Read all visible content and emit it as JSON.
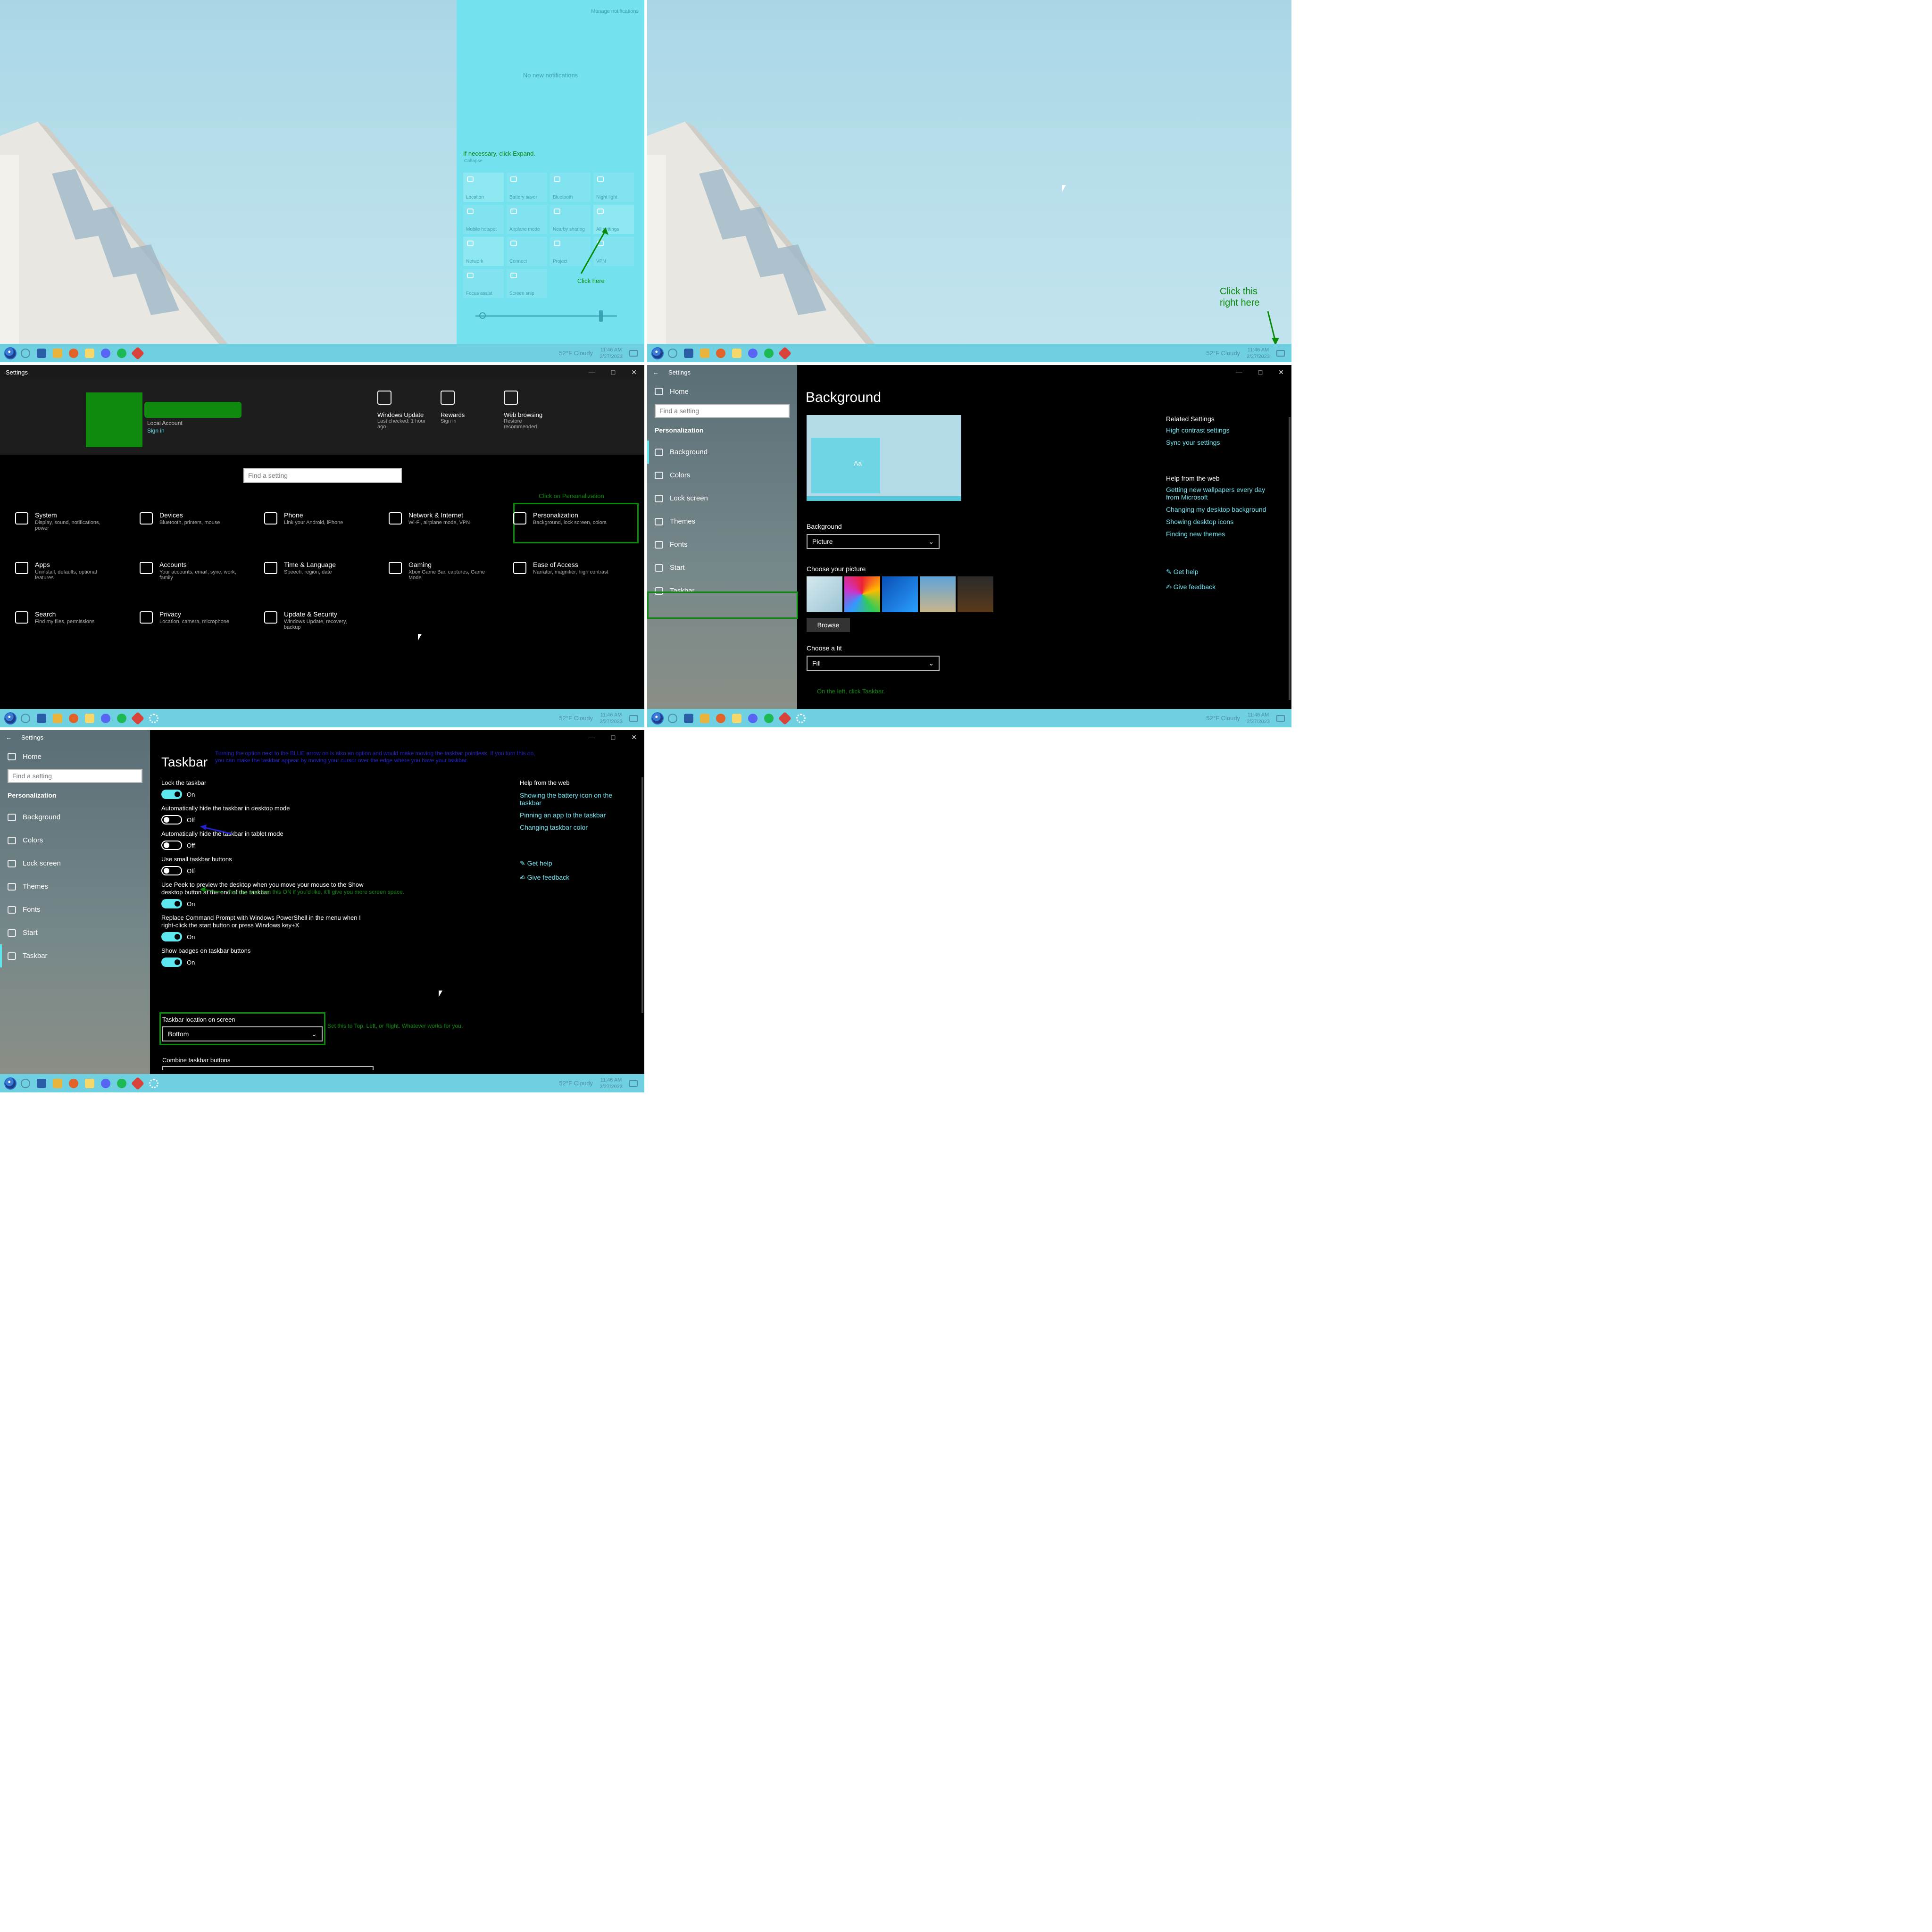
{
  "panel1": {
    "manage_notifications": "Manage notifications",
    "no_notifications": "No new notifications",
    "annotation_expand": "If necessary, click Expand.",
    "collapse": "Collapse",
    "tiles": [
      "Location",
      "Battery saver",
      "Bluetooth",
      "Night light",
      "Mobile hotspot",
      "Airplane mode",
      "Nearby sharing",
      "All settings",
      "Network",
      "Connect",
      "Project",
      "VPN",
      "Focus assist",
      "Screen snip"
    ],
    "annotation_click_here": "Click here"
  },
  "panel2": {
    "annotation_click": "Click this right here"
  },
  "taskbar": {
    "weather": "52°F  Cloudy",
    "time": "11:46 AM",
    "date": "2/27/2023"
  },
  "panel3": {
    "title": "Settings",
    "account_type": "Local Account",
    "sign_in": "Sign in",
    "header_items": [
      {
        "title": "Windows Update",
        "sub": "Last checked: 1 hour ago"
      },
      {
        "title": "Rewards",
        "sub": "Sign in"
      },
      {
        "title": "Web browsing",
        "sub": "Restore recommended"
      }
    ],
    "search_placeholder": "Find a setting",
    "annotation": "Click on Personalization",
    "categories": [
      {
        "title": "System",
        "sub": "Display, sound, notifications, power"
      },
      {
        "title": "Devices",
        "sub": "Bluetooth, printers, mouse"
      },
      {
        "title": "Phone",
        "sub": "Link your Android, iPhone"
      },
      {
        "title": "Network & Internet",
        "sub": "Wi-Fi, airplane mode, VPN"
      },
      {
        "title": "Personalization",
        "sub": "Background, lock screen, colors"
      },
      {
        "title": "Apps",
        "sub": "Uninstall, defaults, optional features"
      },
      {
        "title": "Accounts",
        "sub": "Your accounts, email, sync, work, family"
      },
      {
        "title": "Time & Language",
        "sub": "Speech, region, date"
      },
      {
        "title": "Gaming",
        "sub": "Xbox Game Bar, captures, Game Mode"
      },
      {
        "title": "Ease of Access",
        "sub": "Narrator, magnifier, high contrast"
      },
      {
        "title": "Search",
        "sub": "Find my files, permissions"
      },
      {
        "title": "Privacy",
        "sub": "Location, camera, microphone"
      },
      {
        "title": "Update & Security",
        "sub": "Windows Update, recovery, backup"
      }
    ]
  },
  "panel4": {
    "title": "Settings",
    "home": "Home",
    "search_placeholder": "Find a setting",
    "section": "Personalization",
    "nav": [
      "Background",
      "Colors",
      "Lock screen",
      "Themes",
      "Fonts",
      "Start",
      "Taskbar"
    ],
    "heading": "Background",
    "preview_text": "Aa",
    "background_label": "Background",
    "background_value": "Picture",
    "choose_picture": "Choose your picture",
    "browse": "Browse",
    "choose_fit": "Choose a fit",
    "fit_value": "Fill",
    "annotation": "On the left, click Taskbar.",
    "related_title": "Related Settings",
    "related_links": [
      "High contrast settings",
      "Sync your settings"
    ],
    "help_title": "Help from the web",
    "help_links": [
      "Getting new wallpapers every day from Microsoft",
      "Changing my desktop background",
      "Showing desktop icons",
      "Finding new themes"
    ],
    "get_help": "Get help",
    "give_feedback": "Give feedback"
  },
  "panel5": {
    "title": "Settings",
    "home": "Home",
    "search_placeholder": "Find a setting",
    "section": "Personalization",
    "nav": [
      "Background",
      "Colors",
      "Lock screen",
      "Themes",
      "Fonts",
      "Start",
      "Taskbar"
    ],
    "heading": "Taskbar",
    "annotation_blue": "Turning the option next to the BLUE arrow on is also an option and would make moving the taskbar pointless. If you turn this on, you can make the taskbar appear by moving your cursor over the edge where you have your taskbar.",
    "settings": [
      {
        "label": "Lock the taskbar",
        "state": "On"
      },
      {
        "label": "Automatically hide the taskbar in desktop mode",
        "state": "Off"
      },
      {
        "label": "Automatically hide the taskbar in tablet mode",
        "state": "Off"
      },
      {
        "label": "Use small taskbar buttons",
        "state": "Off"
      },
      {
        "label": "Use Peek to preview the desktop when you move your mouse to the Show desktop button at the end of the taskbar",
        "state": "On"
      },
      {
        "label": "Replace Command Prompt with Windows PowerShell in the menu when I right-click the start button or press Windows key+X",
        "state": "On"
      },
      {
        "label": "Show badges on taskbar buttons",
        "state": "On"
      }
    ],
    "annotation_small": "You can also turn this ON if you'd like, it'll give you more screen space.",
    "location_label": "Taskbar location on screen",
    "location_value": "Bottom",
    "annotation_location": "Set this to Top, Left, or Right. Whatever works for you.",
    "combine_label": "Combine taskbar buttons",
    "help_title": "Help from the web",
    "help_links": [
      "Showing the battery icon on the taskbar",
      "Pinning an app to the taskbar",
      "Changing taskbar color"
    ],
    "get_help": "Get help",
    "give_feedback": "Give feedback"
  },
  "colors": {
    "accent": "#5ee6ee",
    "taskbar": "#6fd0e2",
    "annotation_green": "#0a8a0a",
    "annotation_blue": "#2222cc"
  }
}
